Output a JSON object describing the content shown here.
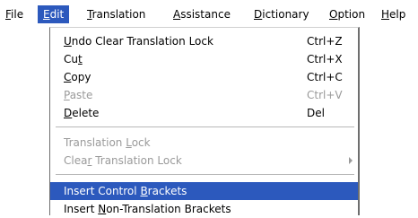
{
  "menubar": {
    "items": [
      {
        "pre": "",
        "key": "F",
        "post": "ile"
      },
      {
        "pre": "",
        "key": "E",
        "post": "dit"
      },
      {
        "pre": "",
        "key": "T",
        "post": "ranslation"
      },
      {
        "pre": "",
        "key": "A",
        "post": "ssistance"
      },
      {
        "pre": "",
        "key": "D",
        "post": "ictionary"
      },
      {
        "pre": "",
        "key": "O",
        "post": "ption"
      },
      {
        "pre": "",
        "key": "H",
        "post": "elp"
      }
    ],
    "active_index": 1
  },
  "edit_menu": {
    "items": [
      {
        "pre": "",
        "key": "U",
        "post": "ndo Clear Translation Lock",
        "shortcut": "Ctrl+Z",
        "enabled": true
      },
      {
        "pre": "Cu",
        "key": "t",
        "post": "",
        "shortcut": "Ctrl+X",
        "enabled": true
      },
      {
        "pre": "",
        "key": "C",
        "post": "opy",
        "shortcut": "Ctrl+C",
        "enabled": true
      },
      {
        "pre": "",
        "key": "P",
        "post": "aste",
        "shortcut": "Ctrl+V",
        "enabled": false
      },
      {
        "pre": "",
        "key": "D",
        "post": "elete",
        "shortcut": "Del",
        "enabled": true
      },
      {
        "pre": "Translation ",
        "key": "L",
        "post": "ock",
        "shortcut": "",
        "enabled": false
      },
      {
        "pre": "Clea",
        "key": "r",
        "post": " Translation Lock",
        "shortcut": "",
        "enabled": false,
        "submenu_arrow": "chevron-right-icon"
      },
      {
        "pre": "Insert Control ",
        "key": "B",
        "post": "rackets",
        "shortcut": "",
        "enabled": true,
        "selected": true
      },
      {
        "pre": "Insert ",
        "key": "N",
        "post": "on-Translation Brackets",
        "shortcut": "",
        "enabled": true
      }
    ]
  },
  "colors": {
    "highlight": "#2c59bd",
    "disabled_text": "#9a9a9a",
    "separator": "#b8b8b8"
  }
}
